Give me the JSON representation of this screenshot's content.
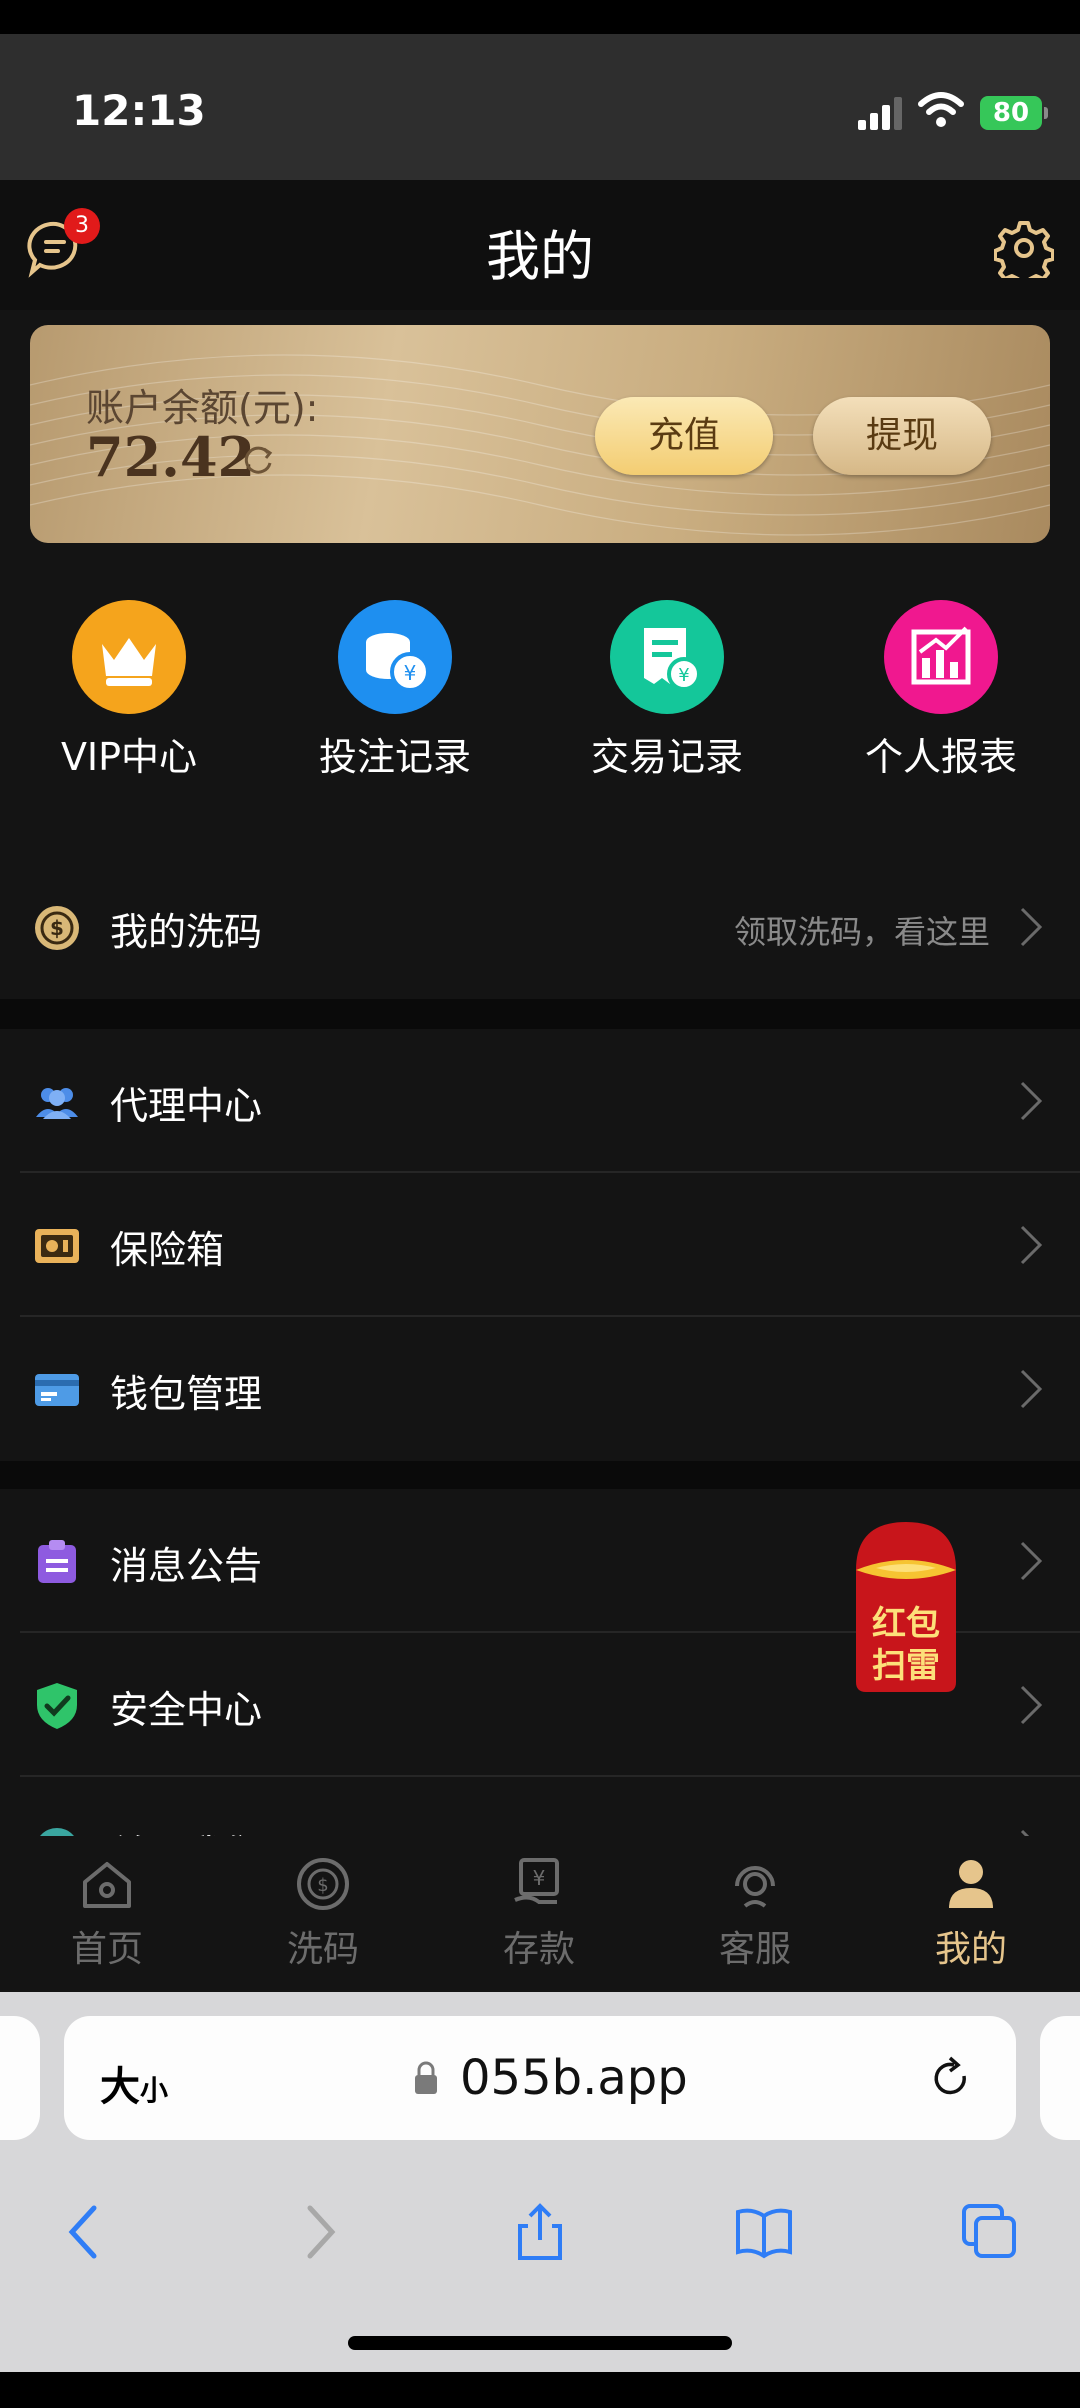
{
  "status_bar": {
    "time": "12:13",
    "battery": "80"
  },
  "header": {
    "title": "我的",
    "badge_count": "3"
  },
  "balance": {
    "label": "账户余额(元):",
    "value": "72.42",
    "recharge_label": "充值",
    "withdraw_label": "提现"
  },
  "quick_actions": [
    {
      "label": "VIP中心",
      "icon": "vip-crown-icon",
      "color": "#f5a41c"
    },
    {
      "label": "投注记录",
      "icon": "coins-icon",
      "color": "#1e8ff0"
    },
    {
      "label": "交易记录",
      "icon": "receipt-icon",
      "color": "#14c79a"
    },
    {
      "label": "个人报表",
      "icon": "chart-icon",
      "color": "#f0188f"
    }
  ],
  "menu": {
    "wash": {
      "label": "我的洗码",
      "hint": "领取洗码，看这里"
    },
    "agent": {
      "label": "代理中心"
    },
    "safe": {
      "label": "保险箱"
    },
    "wallet": {
      "label": "钱包管理"
    },
    "notice": {
      "label": "消息公告"
    },
    "security": {
      "label": "安全中心"
    },
    "about": {
      "label": "关于我们"
    }
  },
  "red_packet": {
    "line1": "红包",
    "line2": "扫雷"
  },
  "tabbar": [
    {
      "label": "首页",
      "icon": "home-icon"
    },
    {
      "label": "洗码",
      "icon": "wash-chip-icon"
    },
    {
      "label": "存款",
      "icon": "deposit-icon"
    },
    {
      "label": "客服",
      "icon": "support-icon"
    },
    {
      "label": "我的",
      "icon": "user-icon",
      "active": true
    }
  ],
  "browser": {
    "text_size_label": "大",
    "text_size_small": "小",
    "url": "055b.app"
  },
  "colors": {
    "gold_accent": "#e6c58c",
    "badge_red": "#e11a1a",
    "background": "#141414"
  }
}
